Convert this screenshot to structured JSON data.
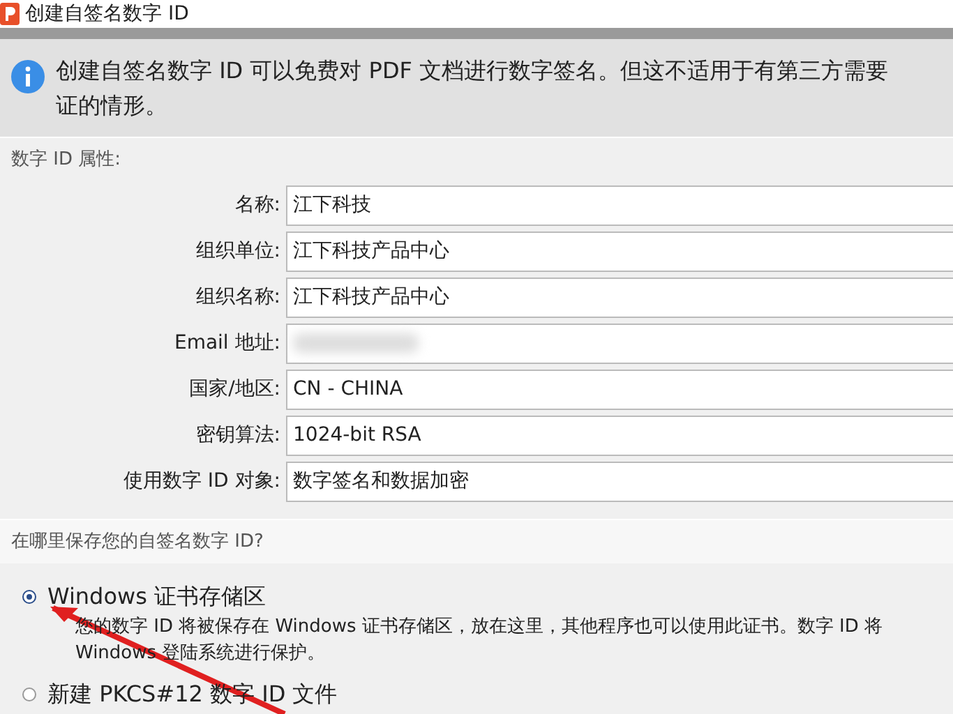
{
  "window": {
    "title": "创建自签名数字 ID"
  },
  "info": {
    "lines": [
      "创建自签名数字 ID 可以免费对 PDF 文档进行数字签名。但这不适用于有第三方需要",
      "证的情形。"
    ]
  },
  "properties": {
    "heading": "数字 ID 属性:",
    "fields": [
      {
        "label": "名称:",
        "value": "江下科技"
      },
      {
        "label": "组织单位:",
        "value": "江下科技产品中心"
      },
      {
        "label": "组织名称:",
        "value": "江下科技产品中心"
      },
      {
        "label": "Email 地址:",
        "blurred": true
      },
      {
        "label": "国家/地区:",
        "value": "CN - CHINA"
      },
      {
        "label": "密钥算法:",
        "value": "1024-bit RSA"
      },
      {
        "label": "使用数字 ID 对象:",
        "value": "数字签名和数据加密"
      }
    ]
  },
  "storage": {
    "heading": "在哪里保存您的自签名数字 ID?",
    "options": [
      {
        "label": "Windows 证书存储区",
        "selected": true,
        "description": [
          "您的数字 ID 将被保存在 Windows 证书存储区，放在这里，其他程序也可以使用此证书。数字 ID 将",
          "Windows 登陆系统进行保护。"
        ]
      },
      {
        "label": "新建 PKCS#12 数字 ID 文件",
        "selected": false
      }
    ]
  }
}
